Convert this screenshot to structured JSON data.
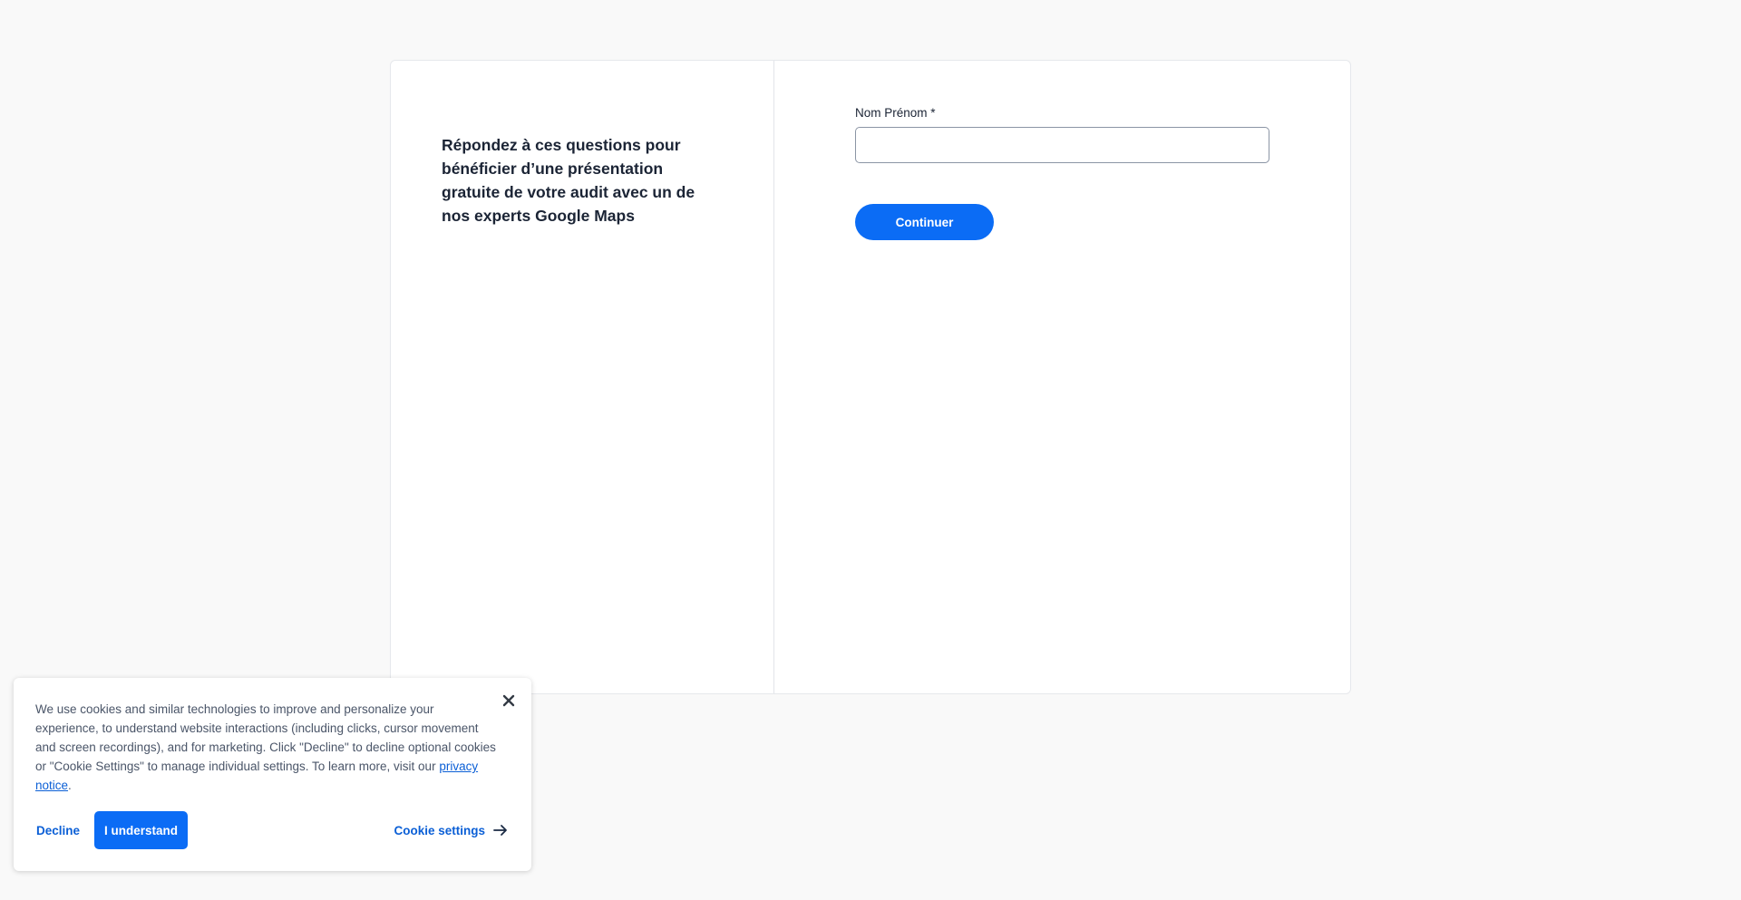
{
  "intro": {
    "text": "Répondez à ces questions pour bénéficier d’une présentation gratuite de votre audit avec un de nos experts Google Maps"
  },
  "form": {
    "name_label": "Nom Prénom *",
    "name_value": "",
    "name_placeholder": "",
    "continue_label": "Continuer"
  },
  "cookie_banner": {
    "text_before_link": "We use cookies and similar technologies to improve and personalize your experience, to understand website interactions (including clicks, cursor movement and screen recordings), and for marketing. Click \"Decline\" to decline optional cookies or \"Cookie Settings\" to manage individual settings. To learn more, visit our ",
    "link_text": "privacy notice",
    "text_after_link": ".",
    "decline_label": "Decline",
    "accept_label": "I understand",
    "settings_label": "Cookie settings",
    "close_icon": "close-icon",
    "settings_icon": "arrow-right-icon"
  },
  "colors": {
    "accent": "#0b6cf5",
    "link": "#0b5fd6",
    "background": "#f9f9f9",
    "text": "#1b2435"
  }
}
